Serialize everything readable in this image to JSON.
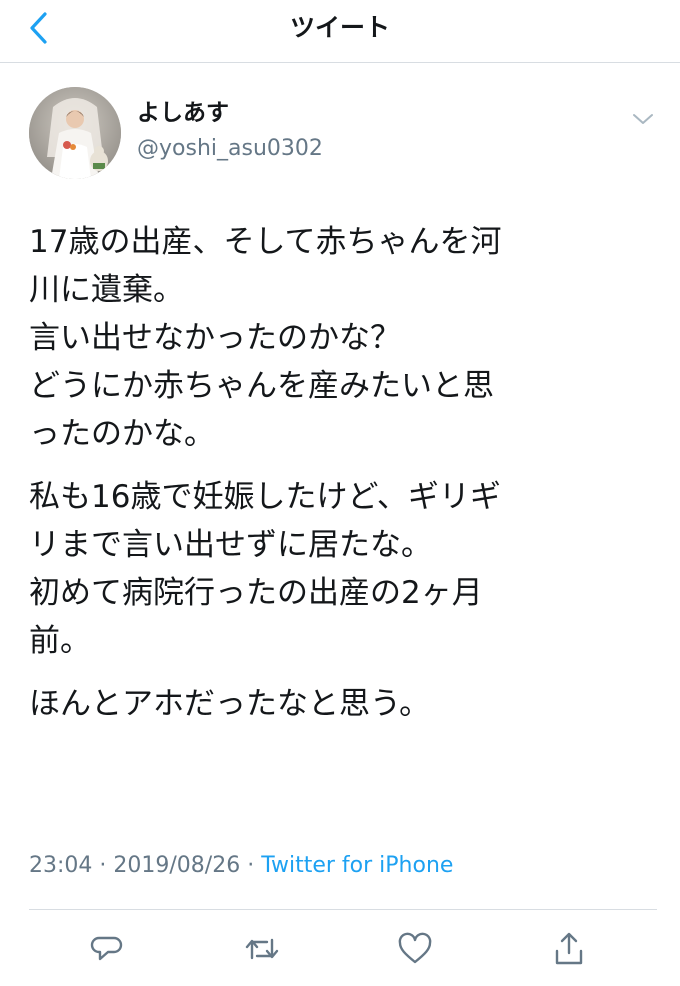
{
  "navbar": {
    "title": "ツイート",
    "back_icon": "chevron-left-icon"
  },
  "author": {
    "display_name": "よしあす",
    "handle": "@yoshi_asu0302"
  },
  "tweet": {
    "paragraphs": [
      [
        "17歳の出産、そして赤ちゃんを河",
        "川に遺棄。",
        "言い出せなかったのかな？",
        "どうにか赤ちゃんを産みたいと思",
        "ったのかな。"
      ],
      [
        "私も16歳で妊娠したけど、ギリギ",
        "リまで言い出せずに居たな。",
        "初めて病院行ったの出産の2ヶ月",
        "前。"
      ],
      [
        "ほんとアホだったなと思う。"
      ]
    ]
  },
  "meta": {
    "time": "23:04",
    "separator1": " · ",
    "date": "2019/08/26",
    "separator2": " · ",
    "source": "Twitter for iPhone"
  },
  "actions": {
    "reply_icon": "reply-icon",
    "retweet_icon": "retweet-icon",
    "like_icon": "heart-icon",
    "share_icon": "share-icon"
  },
  "colors": {
    "accent": "#1da1f2",
    "muted": "#657786",
    "text": "#14171a",
    "divider": "#d8dde2"
  }
}
